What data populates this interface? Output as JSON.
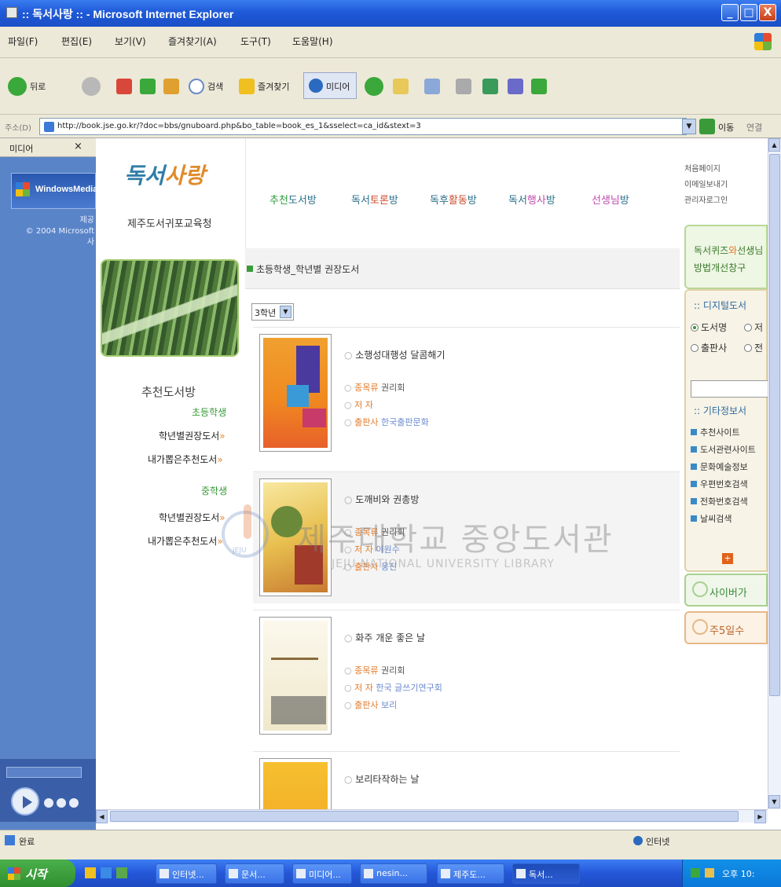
{
  "window": {
    "title": ":: 독서사랑 :: - Microsoft Internet Explorer",
    "buttons": {
      "minimize": "_",
      "maximize": "□",
      "close": "X"
    }
  },
  "menu": [
    "파일(F)",
    "편집(E)",
    "보기(V)",
    "즐겨찾기(A)",
    "도구(T)",
    "도움말(H)"
  ],
  "toolbar": {
    "back": "뒤로",
    "search": "검색",
    "favorites": "즐겨찾기",
    "media": "미디어"
  },
  "address": {
    "label": "주소(D)",
    "url": "http://book.jse.go.kr/?doc=bbs/gnuboard.php&bo_table=book_es_1&sselect=ca_id&stext=3",
    "go": "이동",
    "links": "연결"
  },
  "left_pane": {
    "title": "미디어",
    "close": "×",
    "banner": "WindowsMedia",
    "copyright": "제공\n© 2004 Microsoft\n사"
  },
  "site": {
    "logo": {
      "part1": "독서",
      "part2": "사랑"
    },
    "org": "제주도서귀포교육청",
    "nav": [
      {
        "hl": "추천",
        "rest": "도서방"
      },
      {
        "pre": "독서",
        "hl": "토론",
        "rest": "방"
      },
      {
        "pre": "독후",
        "hl": "활동",
        "rest": "방"
      },
      {
        "pre": "독서",
        "hl": "행사",
        "rest": "방"
      },
      {
        "hl": "선생님",
        "rest": "방"
      }
    ],
    "quick_links": [
      "처음페이지",
      "이메일보내기",
      "관리자로그인"
    ]
  },
  "sidebar": {
    "heading": "추천도서방",
    "items": [
      {
        "label": "초등학생",
        "green": true
      },
      {
        "label": "학년별권장도서",
        "arrow": "»"
      },
      {
        "label": "내가뽑은추천도서",
        "arrow": "»"
      },
      {
        "label": "중학생",
        "green": true
      },
      {
        "label": "학년별권장도서",
        "arrow": "»"
      },
      {
        "label": "내가뽑은추천도서",
        "arrow": "»"
      }
    ]
  },
  "content": {
    "section_title": "초등학생_학년별 권장도서",
    "grade_select": "3학년",
    "books": [
      {
        "title": "소행성대행성 달콤해기",
        "category_label": "종목류",
        "category": "권리회",
        "author_label": "저  자",
        "author": "",
        "publisher_label": "출판사",
        "publisher": "한국출판문화"
      },
      {
        "title": "도깨비와 권총방",
        "category_label": "종목류",
        "category": "권리회",
        "author_label": "저  자",
        "author": "이원수",
        "publisher_label": "출판사",
        "publisher": "웅진"
      },
      {
        "title": "화주 개운 좋은 날",
        "category_label": "종목류",
        "category": "권리회",
        "author_label": "저  자",
        "author": "한국 글쓰기연구회",
        "publisher_label": "출판사",
        "publisher": "보리"
      },
      {
        "title": "보리타작하는 날",
        "category_label": "",
        "category": "",
        "author_label": "",
        "author": "",
        "publisher_label": "",
        "publisher": ""
      }
    ]
  },
  "right": {
    "banner1": {
      "line1_pre": "독서퀴즈",
      "line1_hl": "와",
      "line1_post": "선생님",
      "line2": "방법개선창구"
    },
    "digital_head": ":: 디지털도서",
    "radio_opts": [
      {
        "label": "도서명",
        "on": true
      },
      {
        "label": "저",
        "on": false
      },
      {
        "label": "출판사",
        "on": false
      },
      {
        "label": "전",
        "on": false
      }
    ],
    "other_head": ":: 기타정보서",
    "links": [
      "추천사이트",
      "도서관련사이트",
      "문화예술정보",
      "우편번호검색",
      "전화번호검색",
      "날씨검색"
    ],
    "plus": "+",
    "banner3": "사이버가",
    "banner4": "주5일수"
  },
  "watermark": {
    "line1": "제주대학교 중앙도서관",
    "line2": "JEJU NATIONAL UNIVERSITY LIBRARY",
    "badge": "JEJU"
  },
  "status": {
    "text": "완료",
    "zone": "인터넷"
  },
  "taskbar": {
    "start": "시작",
    "tasks": [
      "인터넷...",
      "문서...",
      "미디어...",
      "nesin...",
      "제주도...",
      "독서..."
    ],
    "tray": "오후 10:"
  }
}
